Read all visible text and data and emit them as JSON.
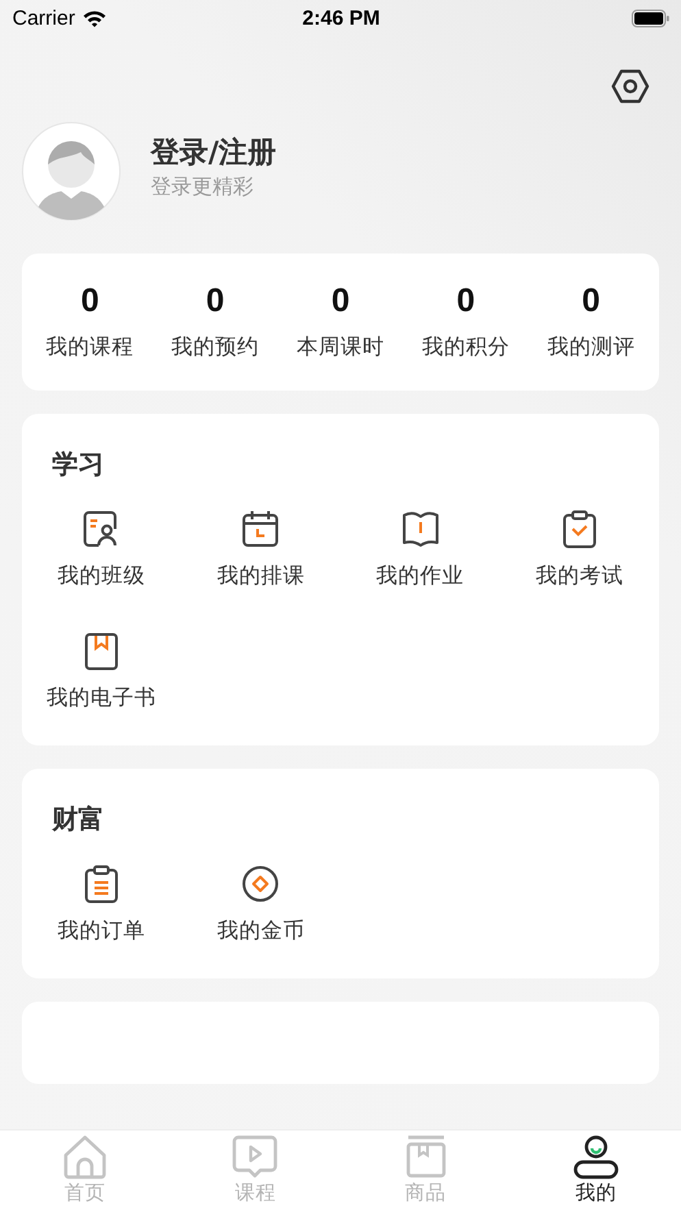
{
  "status_bar": {
    "carrier": "Carrier",
    "time": "2:46 PM"
  },
  "profile": {
    "title": "登录/注册",
    "subtitle": "登录更精彩"
  },
  "stats": [
    {
      "value": "0",
      "label": "我的课程"
    },
    {
      "value": "0",
      "label": "我的预约"
    },
    {
      "value": "0",
      "label": "本周课时"
    },
    {
      "value": "0",
      "label": "我的积分"
    },
    {
      "value": "0",
      "label": "我的测评"
    }
  ],
  "sections": [
    {
      "title": "学习",
      "items": [
        {
          "label": "我的班级"
        },
        {
          "label": "我的排课"
        },
        {
          "label": "我的作业"
        },
        {
          "label": "我的考试"
        },
        {
          "label": "我的电子书"
        }
      ]
    },
    {
      "title": "财富",
      "items": [
        {
          "label": "我的订单"
        },
        {
          "label": "我的金币"
        }
      ]
    }
  ],
  "tabs": [
    {
      "label": "首页",
      "selected": false
    },
    {
      "label": "课程",
      "selected": false
    },
    {
      "label": "商品",
      "selected": false
    },
    {
      "label": "我的",
      "selected": true
    }
  ]
}
